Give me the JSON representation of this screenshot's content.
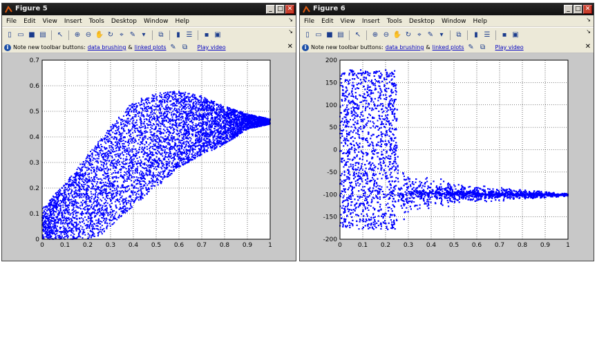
{
  "windows": [
    {
      "title": "Figure 5",
      "menu": [
        "File",
        "Edit",
        "View",
        "Insert",
        "Tools",
        "Desktop",
        "Window",
        "Help"
      ],
      "note": {
        "text": "Note new toolbar buttons:",
        "link1": "data brushing",
        "amp": "&",
        "link2": "linked plots",
        "video": "Play video"
      },
      "chart_data": {
        "type": "scatter",
        "x_ticks": [
          "0",
          "0.1",
          "0.2",
          "0.3",
          "0.4",
          "0.5",
          "0.6",
          "0.7",
          "0.8",
          "0.9",
          "1"
        ],
        "y_ticks": [
          "0",
          "0.1",
          "0.2",
          "0.3",
          "0.4",
          "0.5",
          "0.6",
          "0.7"
        ],
        "xlim": [
          0,
          1
        ],
        "ylim": [
          0,
          0.7
        ],
        "grid": true,
        "marker_color": "#0000ff",
        "point_count_estimate": "dense (tens of thousands)",
        "envelope_upper": [
          [
            0,
            0.12
          ],
          [
            0.1,
            0.22
          ],
          [
            0.2,
            0.33
          ],
          [
            0.3,
            0.44
          ],
          [
            0.4,
            0.54
          ],
          [
            0.5,
            0.57
          ],
          [
            0.6,
            0.58
          ],
          [
            0.7,
            0.56
          ],
          [
            0.8,
            0.52
          ],
          [
            0.9,
            0.49
          ],
          [
            1.0,
            0.47
          ]
        ],
        "envelope_lower": [
          [
            0,
            0
          ],
          [
            0.2,
            0
          ],
          [
            0.25,
            0.01
          ],
          [
            0.3,
            0.05
          ],
          [
            0.4,
            0.13
          ],
          [
            0.5,
            0.2
          ],
          [
            0.6,
            0.28
          ],
          [
            0.7,
            0.33
          ],
          [
            0.8,
            0.37
          ],
          [
            0.9,
            0.43
          ],
          [
            1.0,
            0.45
          ]
        ]
      }
    },
    {
      "title": "Figure 6",
      "menu": [
        "File",
        "Edit",
        "View",
        "Insert",
        "Tools",
        "Desktop",
        "Window",
        "Help"
      ],
      "note": {
        "text": "Note new toolbar buttons:",
        "link1": "data brushing",
        "amp": "&",
        "link2": "linked plots",
        "video": "Play video"
      },
      "chart_data": {
        "type": "scatter",
        "x_ticks": [
          "0",
          "0.1",
          "0.2",
          "0.3",
          "0.4",
          "0.5",
          "0.6",
          "0.7",
          "0.8",
          "0.9",
          "1"
        ],
        "y_ticks": [
          "-200",
          "-150",
          "-100",
          "-50",
          "0",
          "50",
          "100",
          "150",
          "200"
        ],
        "xlim": [
          0,
          1
        ],
        "ylim": [
          -200,
          200
        ],
        "grid": true,
        "marker_color": "#0000ff",
        "point_count_estimate": "dense (tens of thousands)",
        "envelope_upper": [
          [
            0,
            178
          ],
          [
            0.25,
            178
          ],
          [
            0.26,
            -40
          ],
          [
            0.4,
            -62
          ],
          [
            0.6,
            -78
          ],
          [
            0.8,
            -88
          ],
          [
            1.0,
            -98
          ]
        ],
        "envelope_lower": [
          [
            0,
            -178
          ],
          [
            0.25,
            -178
          ],
          [
            0.3,
            -150
          ],
          [
            0.4,
            -133
          ],
          [
            0.6,
            -120
          ],
          [
            0.8,
            -112
          ],
          [
            1.0,
            -104
          ]
        ]
      }
    }
  ]
}
